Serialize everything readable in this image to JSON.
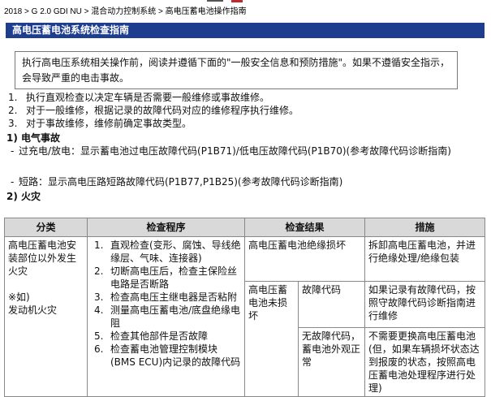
{
  "breadcrumb": "2018 > G 2.0 GDI NU > 混合动力控制系统 > 高电压蓄电池操作指南",
  "title": "高电压蓄电池系统检查指南",
  "warning": "执行高电压系统相关操作前，阅读并遵循下面的\"一般安全信息和预防措施\"。如果不遵循安全指示，会导致严重的电击事故。",
  "steps": [
    {
      "num": "1.",
      "text": "执行直观检查以决定车辆是否需要一般维修或事故维修。"
    },
    {
      "num": "2.",
      "text": "对于一般维修，根据记录的故障代码对应的维修程序执行维修。"
    },
    {
      "num": "3.",
      "text": "对于事故维修，维修前确定事故类型。"
    }
  ],
  "section1": {
    "heading": "1) 电气事故",
    "items": [
      {
        "dash": "-",
        "text": "过充电/放电：显示蓄电池过电压故障代码(P1B71)/低电压故障代码(P1B70)(参考故障代码诊断指南)"
      },
      {
        "dash": "-",
        "text": "短路：显示高电压路短路故障代码(P1B77,P1B25)(参考故障代码诊断指南)"
      }
    ]
  },
  "section2": {
    "heading": "2) 火灾"
  },
  "table": {
    "headers": [
      "分类",
      "检查程序",
      "检查结果",
      "措施"
    ],
    "category": "高电压蓄电池安装部位以外发生火灾",
    "category_note": "※如)",
    "category_example": "发动机火灾",
    "procedures": [
      {
        "num": "1.",
        "text": "直观检查(变形、腐蚀、导线绝缘层、气味、连接器)"
      },
      {
        "num": "2.",
        "text": "切断高电压后，检查主保险丝电路是否断路"
      },
      {
        "num": "3.",
        "text": "检查高电压主继电器是否粘附"
      },
      {
        "num": "4.",
        "text": "测量高电压蓄电池/底盘绝缘电阻"
      },
      {
        "num": "5.",
        "text": "检查其他部件是否故障"
      },
      {
        "num": "6.",
        "text": "检查蓄电池管理控制模块(BMS ECU)内记录的故障代码"
      }
    ],
    "result_insulation": "高电压蓄电池绝缘损坏",
    "action_insulation": "拆卸高电压蓄电池，并进行绝缘处理/绝缘包装",
    "result_undamaged": "高电压蓄电池未损坏",
    "result_code": "故障代码",
    "action_code": "如果记录有故障代码，按照守故障代码诊断指南进行维修",
    "result_no_code": "无故障代码，蓄电池外观正常",
    "action_no_code": "不需要更换高电压蓄电池(但，如果车辆损坏状态达到报废的状态，按照高电压蓄电池处理程序进行处理)"
  },
  "colors": {
    "title_bg": "#1e3d8f",
    "header_bg": "#d9d9d9"
  }
}
